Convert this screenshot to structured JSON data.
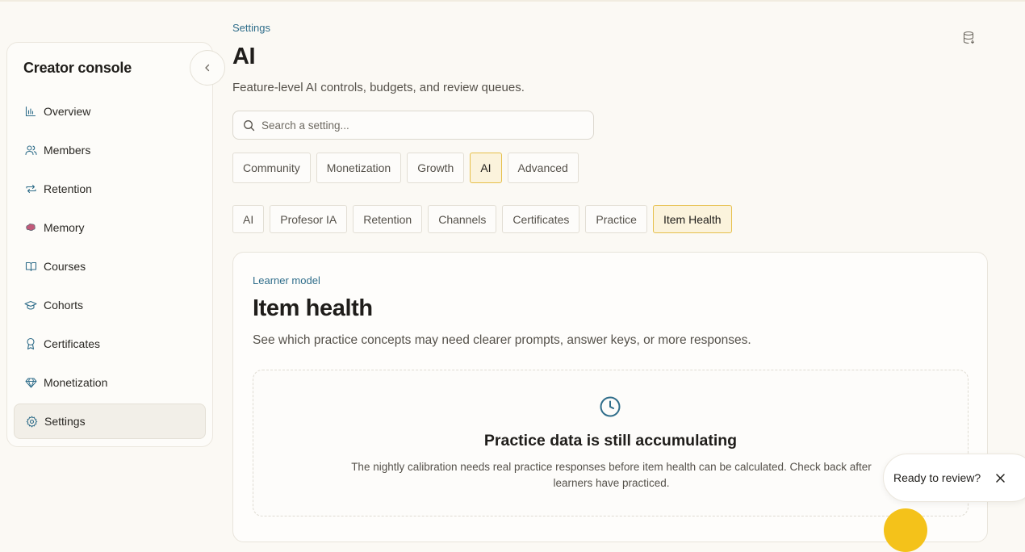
{
  "sidebar": {
    "title": "Creator console",
    "items": [
      {
        "label": "Overview",
        "icon": "chart-icon"
      },
      {
        "label": "Members",
        "icon": "users-icon"
      },
      {
        "label": "Retention",
        "icon": "repeat-icon"
      },
      {
        "label": "Memory",
        "icon": "brain-icon"
      },
      {
        "label": "Courses",
        "icon": "book-icon"
      },
      {
        "label": "Cohorts",
        "icon": "graduation-cap-icon"
      },
      {
        "label": "Certificates",
        "icon": "award-icon"
      },
      {
        "label": "Monetization",
        "icon": "gem-icon"
      },
      {
        "label": "Settings",
        "icon": "gear-icon",
        "active": true
      }
    ]
  },
  "header": {
    "breadcrumb": "Settings",
    "title": "AI",
    "description": "Feature-level AI controls, budgets, and review queues."
  },
  "search": {
    "placeholder": "Search a setting..."
  },
  "category_tabs": {
    "items": [
      "Community",
      "Monetization",
      "Growth",
      "AI",
      "Advanced"
    ],
    "active": "AI"
  },
  "sub_tabs": {
    "items": [
      "AI",
      "Profesor IA",
      "Retention",
      "Channels",
      "Certificates",
      "Practice",
      "Item Health"
    ],
    "active": "Item Health"
  },
  "card": {
    "eyebrow": "Learner model",
    "title": "Item health",
    "description": "See which practice concepts may need clearer prompts, answer keys, or more responses.",
    "empty_state": {
      "icon": "clock-icon",
      "title": "Practice data is still accumulating",
      "text": "The nightly calibration needs real practice responses before item health can be calculated. Check back after learners have practiced."
    }
  },
  "toast": {
    "text": "Ready to review?"
  },
  "colors": {
    "accent": "#2f6d8a",
    "active_tab_border": "#e6bf4a",
    "active_tab_bg": "#fbf3dc",
    "fab": "#f4c21a"
  }
}
